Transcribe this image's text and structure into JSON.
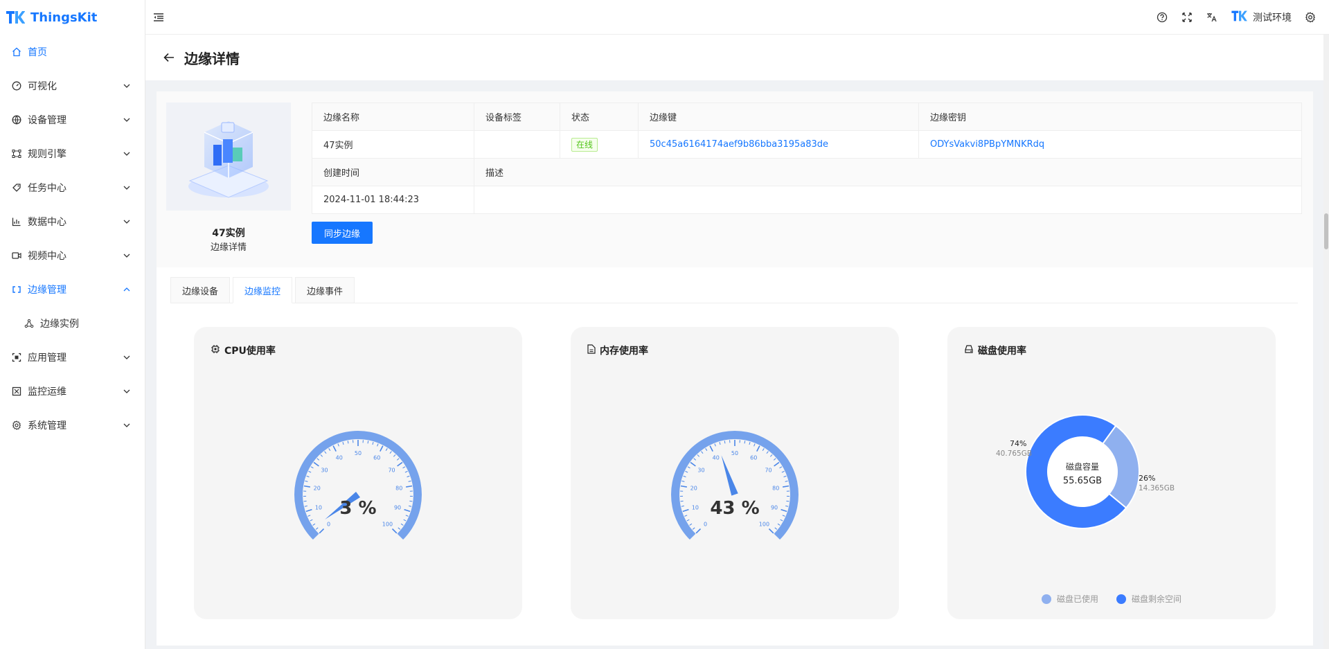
{
  "app": {
    "name": "ThingsKit"
  },
  "sidebar": {
    "items": [
      {
        "label": "首页",
        "icon": "home-icon",
        "active": true,
        "expandable": false
      },
      {
        "label": "可视化",
        "icon": "dashboard-icon",
        "expandable": true
      },
      {
        "label": "设备管理",
        "icon": "device-icon",
        "expandable": true
      },
      {
        "label": "规则引擎",
        "icon": "rule-icon",
        "expandable": true
      },
      {
        "label": "任务中心",
        "icon": "task-icon",
        "expandable": true
      },
      {
        "label": "数据中心",
        "icon": "data-icon",
        "expandable": true
      },
      {
        "label": "视频中心",
        "icon": "video-icon",
        "expandable": true
      },
      {
        "label": "边缘管理",
        "icon": "edge-icon",
        "expandable": true,
        "expanded": true,
        "highlight": true
      },
      {
        "label": "边缘实例",
        "icon": "instance-icon",
        "sub": true
      },
      {
        "label": "应用管理",
        "icon": "app-icon",
        "expandable": true
      },
      {
        "label": "监控运维",
        "icon": "monitor-icon",
        "expandable": true
      },
      {
        "label": "系统管理",
        "icon": "settings-icon",
        "expandable": true
      }
    ]
  },
  "header": {
    "user": "测试环境"
  },
  "page": {
    "title": "边缘详情"
  },
  "instance": {
    "name": "47实例",
    "subtitle": "边缘详情"
  },
  "info": {
    "h_name": "边缘名称",
    "h_tag": "设备标签",
    "h_status": "状态",
    "h_key": "边缘键",
    "h_secret": "边缘密钥",
    "name": "47实例",
    "tag": "",
    "status": "在线",
    "key": "50c45a6164174aef9b86bba3195a83de",
    "secret": "ODYsVakvi8PBpYMNKRdq",
    "h_created": "创建时间",
    "h_desc": "描述",
    "created": "2024-11-01 18:44:23",
    "desc": ""
  },
  "sync_button": "同步边缘",
  "tabs": [
    "边缘设备",
    "边缘监控",
    "边缘事件"
  ],
  "active_tab": 1,
  "cpu": {
    "title": "CPU使用率",
    "value": 3,
    "display": "3 %"
  },
  "memory": {
    "title": "内存使用率",
    "value": 43,
    "display": "43 %"
  },
  "gauge_ticks": [
    "0",
    "10",
    "20",
    "30",
    "40",
    "50",
    "60",
    "70",
    "80",
    "90",
    "100"
  ],
  "disk": {
    "title": "磁盘使用率",
    "center_label": "磁盘容量",
    "center_value": "55.65GB",
    "used_percent": 26,
    "used_pct_label": "26%",
    "used_size": "14.365GB",
    "free_percent": 74,
    "free_pct_label": "74%",
    "free_size": "40.765GB",
    "legend_used": "磁盘已使用",
    "legend_free": "磁盘剩余空间",
    "colors": {
      "used": "#8fb0ef",
      "free": "#3b7cff"
    }
  },
  "colors": {
    "accent": "#1677ff",
    "gauge": "#4a86e8"
  }
}
